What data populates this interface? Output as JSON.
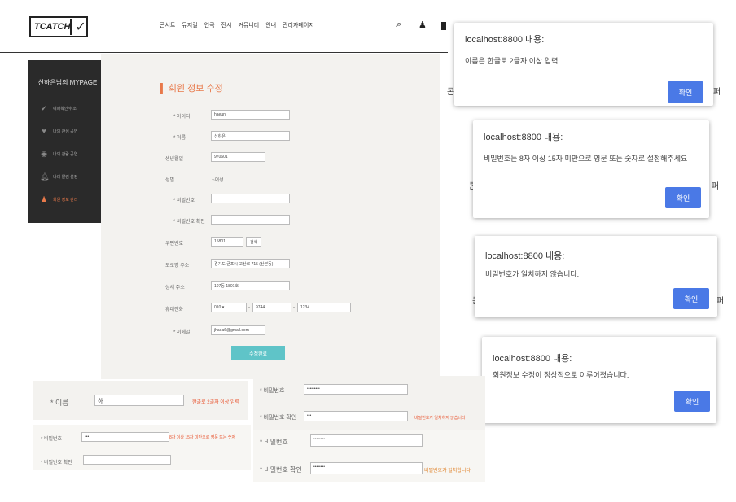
{
  "header": {
    "logo_text": "TCATCH",
    "nav": [
      "콘서트",
      "뮤지컬",
      "연극",
      "전시",
      "커뮤니티",
      "안내",
      "관리자페이지"
    ],
    "icons": [
      "search-icon",
      "user-icon",
      "bookmark-icon"
    ]
  },
  "sidebar": {
    "title": "신하은님의 MYPAGE",
    "items": [
      {
        "icon": "check-icon",
        "label": "예매확인/취소"
      },
      {
        "icon": "heart-icon",
        "label": "나의 관심 공연"
      },
      {
        "icon": "eye-icon",
        "label": "나의 관람 공연"
      },
      {
        "icon": "bell-icon",
        "label": "나의 알림 설정"
      },
      {
        "icon": "user-icon",
        "label": "회원 정보 관리"
      }
    ]
  },
  "form": {
    "title": "회원 정보 수정",
    "id_label": "* 아이디",
    "id_value": "haeun",
    "name_label": "* 이름",
    "name_value": "신하은",
    "birth_label": "생년월일",
    "birth_value": "970601",
    "gender_label": "성별",
    "gender_value": "여성 ",
    "pw_label": "* 비밀번호",
    "pw_value": "",
    "pw_confirm_label": "* 비밀번호 확인",
    "pw_confirm_value": "",
    "zip_label": "우편번호",
    "zip_value": "15801",
    "zip_button": "검색",
    "road_label": "도로명 주소",
    "road_value": "경기도 군포시 고산로 715 (산본동)",
    "detail_label": "상세 주소",
    "detail_value": "107동 1801호",
    "phone_label": "휴대전화",
    "phone1": "010",
    "phone_sep": "-",
    "phone2": "9744",
    "phone3": "1234",
    "email_label": "* 이메일",
    "email_value": "jhaea6@gmail.com",
    "submit": "수정완료"
  },
  "dialogs": [
    {
      "title": "localhost:8800 내용:",
      "message": "이름은 한글로 2글자 이상 입력",
      "button": "확인"
    },
    {
      "title": "localhost:8800 내용:",
      "message": "비밀번호는 8자 이상 15자 미만으로 영문 또는 숫자로 설정해주세요",
      "button": "확인"
    },
    {
      "title": "localhost:8800 내용:",
      "message": "비밀번호가 일치하지 않습니다.",
      "button": "확인"
    },
    {
      "title": "localhost:8800 내용:",
      "message": "회원정보 수정이 정상적으로 이루어졌습니다.",
      "button": "확인"
    }
  ],
  "peek_text": [
    "콘",
    "퍼",
    "콘",
    "퍼",
    "콘",
    "퍼"
  ],
  "snippets": {
    "name": {
      "label": "* 이름",
      "value": "하",
      "error": "한글로 2글자 이상 입력"
    },
    "pw_rule": {
      "pw_label": "* 비밀번호",
      "pw_value": "•••",
      "error": "8자 이상 15자 미만으로 영문 또는 숫자",
      "confirm_label": "* 비밀번호 확인",
      "confirm_value": ""
    },
    "pw_mismatch": {
      "pw_label": "* 비밀번호",
      "pw_value": "•••••••••",
      "confirm_label": "* 비밀번호 확인",
      "confirm_value": "•••",
      "error": "비밀번호가 일치하지 않습니다"
    },
    "pw_match": {
      "pw_label": "* 비밀번호",
      "pw_value": "••••••••",
      "confirm_label": "* 비밀번호 확인",
      "confirm_value": "••••••••",
      "status": "비밀번호가 일치합니다."
    }
  }
}
